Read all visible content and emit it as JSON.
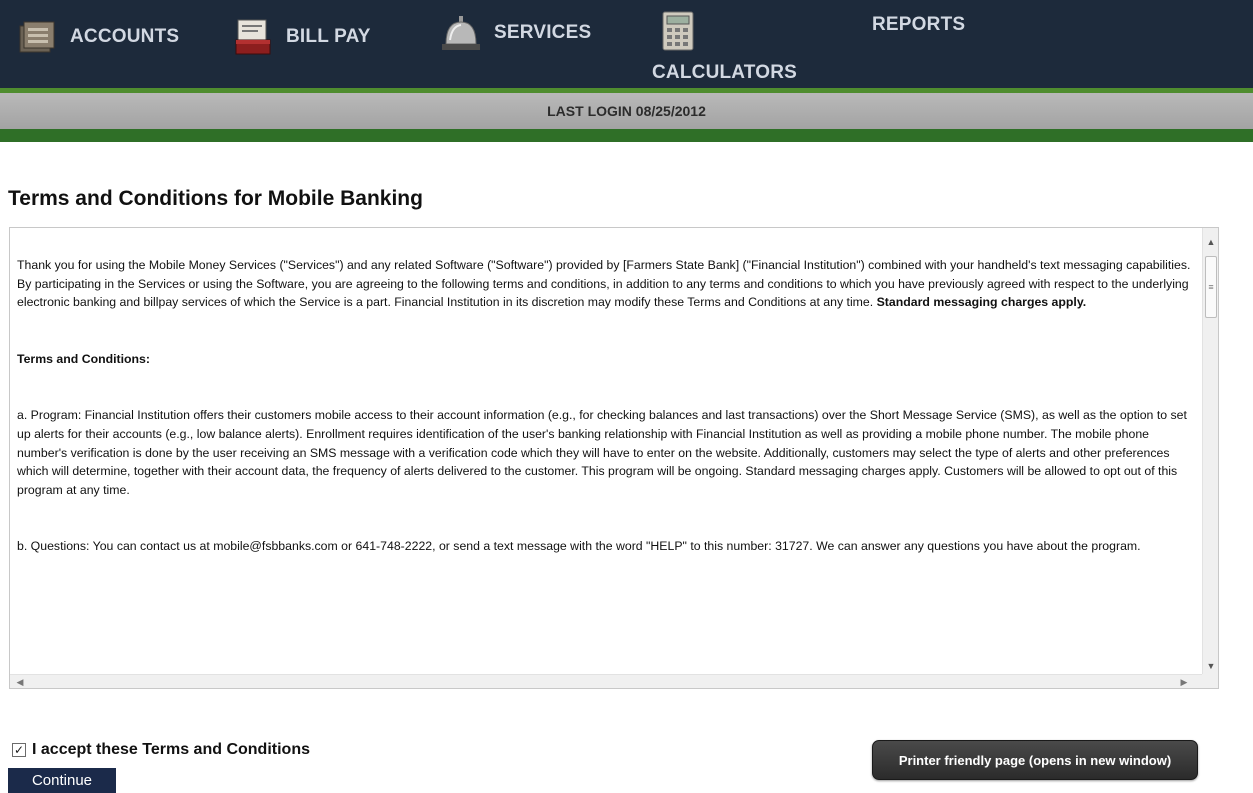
{
  "nav": {
    "accounts": "ACCOUNTS",
    "billpay": "BILL PAY",
    "services": "SERVICES",
    "calculators": "CALCULATORS",
    "reports": "REPORTS"
  },
  "last_login": "LAST LOGIN 08/25/2012",
  "page_title": "Terms and Conditions for Mobile Banking",
  "terms": {
    "intro": "Thank you for using the Mobile Money Services (\"Services\") and any related Software (\"Software\") provided by [Farmers State Bank] (\"Financial Institution\") combined with your handheld's text messaging capabilities. By participating in the Services or using the Software, you are agreeing to the following terms and conditions, in addition to any terms and conditions to which you have previously agreed with respect to the underlying electronic banking and billpay services of which the Service is a part. Financial Institution in its discretion may modify these Terms and Conditions at any time. ",
    "intro_bold": "Standard messaging charges apply.",
    "heading": "Terms and Conditions:",
    "program": "a. Program: Financial Institution offers their customers mobile access to their account information (e.g., for checking balances and last transactions) over the Short Message Service (SMS), as well as the option to set up alerts for their accounts (e.g., low balance alerts). Enrollment requires identification of the user's banking relationship with Financial Institution as well as providing a mobile phone number. The mobile phone number's verification is done by the user receiving an SMS message with a verification code which they will have to enter on the website. Additionally, customers may select the type of alerts and other preferences which will determine, together with their account data, the frequency of alerts delivered to the customer. This program will be ongoing. Standard messaging charges apply. Customers will be allowed to opt out of this program at any time.",
    "questions": "b. Questions: You can contact us at mobile@fsbbanks.com or 641-748-2222, or send a text message with the word \"HELP\" to this number: 31727.  We can answer any questions you have about the program."
  },
  "accept_label": "I accept these Terms and Conditions",
  "accept_checked": true,
  "continue_label": "Continue",
  "print_label": "Printer friendly page (opens in new window)",
  "colors": {
    "nav_bg": "#1d2a3b",
    "accent_green": "#4f8d2f",
    "dark_green": "#2f6f27",
    "continue_bg": "#1b2a4a"
  }
}
